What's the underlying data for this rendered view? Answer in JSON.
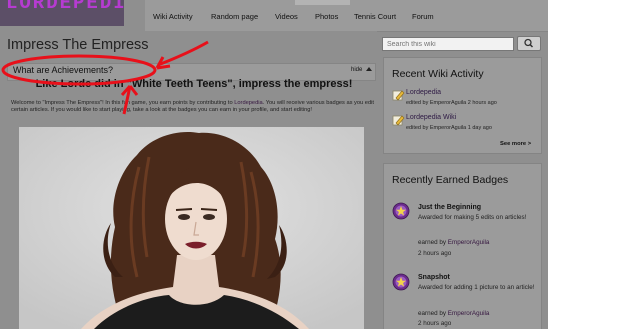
{
  "brand": {
    "logo_text": "LORDEPEDIA"
  },
  "nav": {
    "items": [
      "Wiki Activity",
      "Random page",
      "Videos",
      "Photos",
      "Tennis Court",
      "Forum"
    ]
  },
  "article": {
    "title": "Impress The Empress",
    "section_heading": "What are Achievements?",
    "hide_label": "hide",
    "headline": "Like Lorde did in \"White Teeth Teens\", impress the empress!",
    "body_before_link": "Welcome to \"Impress The Empress\"! In this fun game, you earn points by contributing to ",
    "body_link": "Lordepedia",
    "body_after_link": ". You will receive various badges as you edit certain articles. If you would like to start playing, take a look at the badges you can earn in your profile, and start editing!"
  },
  "search": {
    "placeholder": "Search this wiki"
  },
  "recent_activity": {
    "title": "Recent Wiki Activity",
    "items": [
      {
        "title": "Lordepedia",
        "edited_by": "edited by EmperorAguila 2 hours ago"
      },
      {
        "title": "Lordepedia Wiki",
        "edited_by": "edited by EmperorAguila 1 day ago"
      }
    ],
    "see_more": "See more >"
  },
  "badges": {
    "title": "Recently Earned Badges",
    "items": [
      {
        "name": "Just the Beginning",
        "description": "Awarded for making 5 edits on articles!",
        "earned_by_label": "earned by ",
        "user": "EmperorAguila",
        "time": "2 hours ago"
      },
      {
        "name": "Snapshot",
        "description": "Awarded for adding 1 picture to an article!",
        "earned_by_label": "earned by ",
        "user": "EmperorAguila",
        "time": "2 hours ago"
      }
    ]
  },
  "colors": {
    "annotation_red": "#e8101a",
    "badge_purple": "#6b2b8c",
    "link_purple": "#35163f",
    "page_gray": "#8f8f8f"
  }
}
